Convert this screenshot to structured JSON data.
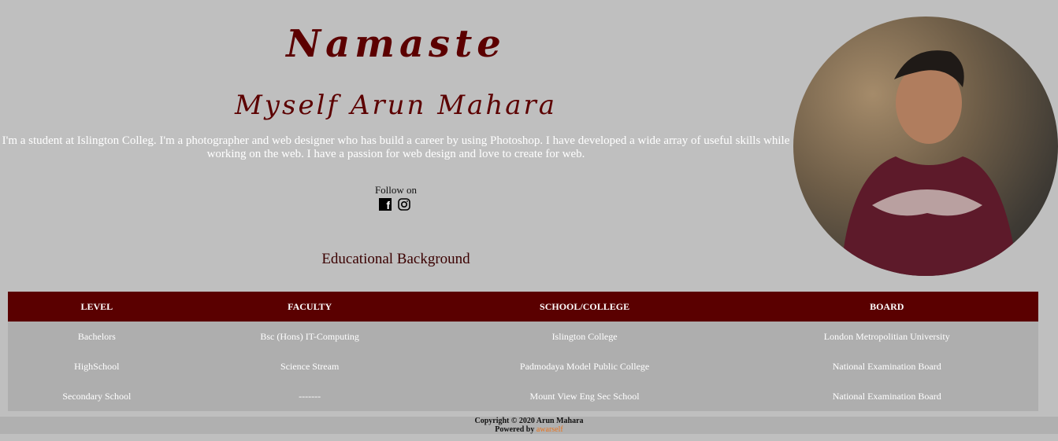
{
  "hero": {
    "greeting": "Namaste",
    "intro": "Myself Arun Mahara",
    "bio": "I'm a student at Islington Colleg. I'm a photographer and web designer who has build a career by using Photoshop. I have developed a wide array of useful skills while working on the web. I have a passion for web design and love to create for web.",
    "follow_label": "Follow on",
    "socials": [
      {
        "icon": "facebook-icon"
      },
      {
        "icon": "instagram-icon"
      }
    ]
  },
  "education": {
    "title": "Educational Background",
    "columns": [
      "LEVEL",
      "FACULTY",
      "SCHOOL/COLLEGE",
      "BOARD"
    ],
    "rows": [
      [
        "Bachelors",
        "Bsc (Hons) IT-Computing",
        "Islington College",
        "London Metropolitian University"
      ],
      [
        "HighSchool",
        "Science Stream",
        "Padmodaya Model Public College",
        "National Examination Board"
      ],
      [
        "Secondary School",
        "-------",
        "Mount View Eng Sec School",
        "National Examination Board"
      ]
    ],
    "header_color": "#5a0000"
  },
  "footer": {
    "copyright": "Copyright © 2020 Arun Mahara",
    "powered_prefix": "Powered by",
    "powered_brand": "awarself"
  }
}
